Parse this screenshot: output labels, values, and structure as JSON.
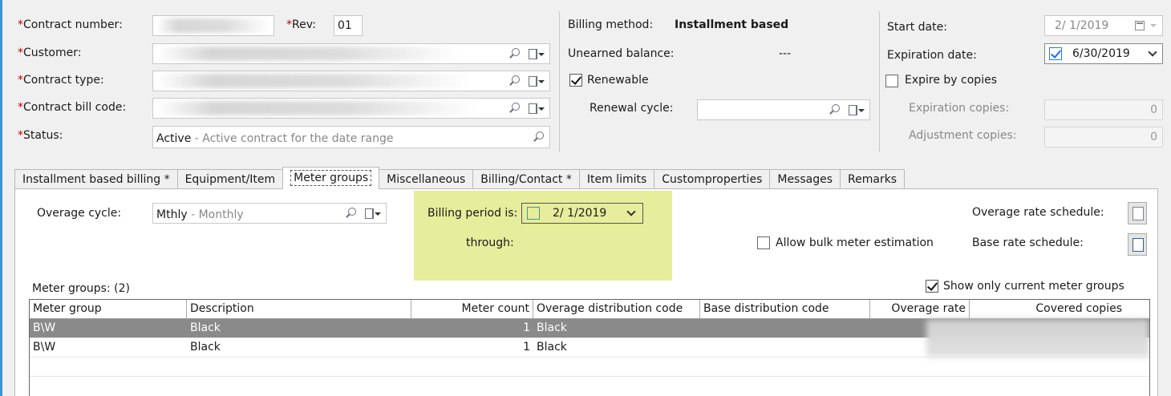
{
  "header": {
    "contract_number_label": "Contract number:",
    "rev_label": "Rev:",
    "rev_value": "01",
    "customer_label": "Customer:",
    "contract_type_label": "Contract type:",
    "contract_bill_code_label": "Contract bill code:",
    "status_label": "Status:",
    "status_code": "Active",
    "status_desc": " - Active contract for the date range",
    "required_marker": "*"
  },
  "billing": {
    "method_label": "Billing method:",
    "method_value": "Installment based",
    "unearned_label": "Unearned balance:",
    "unearned_value": "---",
    "renewable_label": "Renewable",
    "renewable_checked": true,
    "renewal_cycle_label": "Renewal cycle:"
  },
  "dates": {
    "start_label": "Start date:",
    "start_value": "2/  1/2019",
    "expiration_label": "Expiration date:",
    "expiration_value": "6/30/2019",
    "expire_by_copies_label": "Expire by copies",
    "expiration_copies_label": "Expiration copies:",
    "expiration_copies_value": "0",
    "adjustment_copies_label": "Adjustment copies:",
    "adjustment_copies_value": "0"
  },
  "tabs": [
    {
      "label": "Installment based billing *"
    },
    {
      "label": "Equipment/Item"
    },
    {
      "label": "Meter groups",
      "active": true
    },
    {
      "label": "Miscellaneous"
    },
    {
      "label": "Billing/Contact *"
    },
    {
      "label": "Item limits"
    },
    {
      "label": "Customproperties"
    },
    {
      "label": "Messages"
    },
    {
      "label": "Remarks"
    }
  ],
  "meter_tab": {
    "overage_cycle_label": "Overage cycle:",
    "overage_cycle_code": "Mthly",
    "overage_cycle_desc": " - Monthly",
    "billing_period_label": "Billing period is:",
    "billing_period_value": "2/  1/2019",
    "through_label": "through:",
    "allow_bulk_label": "Allow bulk meter estimation",
    "overage_rate_schedule_label": "Overage rate schedule:",
    "base_rate_schedule_label": "Base rate schedule:",
    "meter_groups_count_label": "Meter groups: (2)",
    "show_current_label": "Show only current meter groups",
    "show_current_checked": true
  },
  "grid": {
    "columns": [
      "Meter group",
      "Description",
      "Meter count",
      "Overage distribution code",
      "Base distribution code",
      "Overage rate",
      "Covered copies"
    ],
    "rows": [
      [
        "B\\W",
        "Black",
        "1",
        "Black",
        "",
        "",
        ""
      ],
      [
        "B\\W",
        "Black",
        "1",
        "Black",
        "",
        "",
        ""
      ]
    ]
  },
  "colors": {
    "highlight": "#e6ed9c",
    "required": "#c00000",
    "selected_row": "#8a8a8a",
    "edge_accent": "#3c95d6"
  }
}
